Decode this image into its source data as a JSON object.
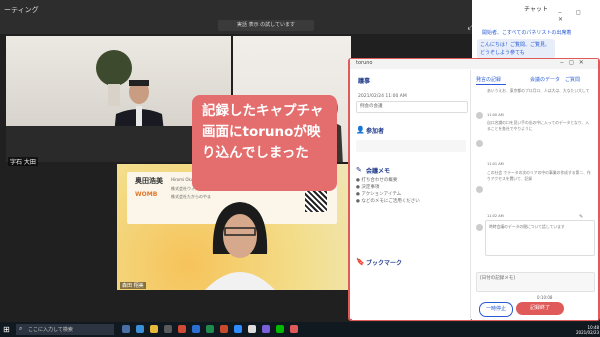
{
  "zoom": {
    "window_title": "ーティング",
    "recording_label": "実話 表示 の試しています",
    "participant_name_1": "字石 大田",
    "participant_name_3": "森田 翔美"
  },
  "business_card": {
    "name_jp": "奥田浩美",
    "name_en": "Hiromi Okuda",
    "company": "WOMB",
    "line1": "株式会社ウィズグループ",
    "line2": "株式会社たからのやま"
  },
  "callout": {
    "text": "記録したキャプチャ画面にtorunoが映り込んでしまった"
  },
  "chat": {
    "title": "チャット",
    "line1": "開始者、こすべてのパネリストの出席着",
    "bubble": "こんにちは！ご覧間、ご覧見、どうぞしよう参ても"
  },
  "toruno": {
    "window_title": "toruno",
    "left_header": "議事",
    "date": "2021/02/24 11:00 AM",
    "meeting_title": "例会の会議",
    "sections": {
      "attendees": "参加者",
      "memo": "会議メモ",
      "bookmark": "ブックマーク"
    },
    "memo_items": [
      "● 打ち合わせの概要",
      "● 決定事項",
      "● アクションアイテム",
      "● などのメモにご活用ください"
    ],
    "tabs": [
      "発言の記録",
      "会議のデータ",
      "ご質問"
    ],
    "messages": [
      "あいうえお、東京都のプロ月ロ、人は大は、大なたい大して",
      "自口名識の口を見い手の出の中に入ってのデータとなり、入ることを各社でやりように",
      "この社会 でテータの次のリアの中の事業の作成する第二、作りアクセスを聞いて、記録",
      "時時会議のデータの間について話しています"
    ],
    "times": [
      "11:00 AM",
      "11:01 AM",
      "11:02 AM",
      "11:03 AM"
    ],
    "note_placeholder": "[日付の記録メモ]",
    "pause_label": "一時停止",
    "end_label": "記録終了",
    "timer": "0:10:08"
  },
  "taskbar": {
    "search_placeholder": "ここに入力して検索",
    "time": "10:48",
    "date": "2021/02/23"
  }
}
